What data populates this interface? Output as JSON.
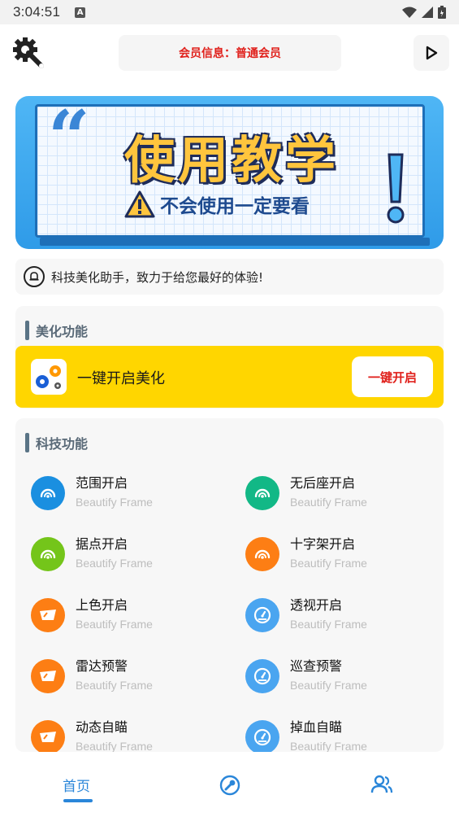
{
  "status_bar": {
    "time": "3:04:51",
    "badge": "A"
  },
  "header": {
    "settings_icon": "settings-wrench-icon",
    "member_info": "会员信息：普通会员",
    "play_icon": "play-icon"
  },
  "banner": {
    "quote_mark": "“",
    "title": "使用教学",
    "subtitle": "不会使用一定要看",
    "exclaim": "!"
  },
  "notice": {
    "icon": "bell-icon",
    "text": "科技美化助手，致力于给您最好的体验!"
  },
  "beautify_section": {
    "title": "美化功能",
    "row": {
      "label": "一键开启美化",
      "button": "一键开启",
      "icon": "gears-icon"
    }
  },
  "tech_section": {
    "title": "科技功能",
    "items": [
      {
        "name": "范围开启",
        "sub": "Beautify Frame",
        "color": "#1a8fe0",
        "icon": "gauge-icon"
      },
      {
        "name": "无后座开启",
        "sub": "Beautify Frame",
        "color": "#12b886",
        "icon": "gauge-icon"
      },
      {
        "name": "据点开启",
        "sub": "Beautify Frame",
        "color": "#74c51a",
        "icon": "gauge-icon"
      },
      {
        "name": "十字架开启",
        "sub": "Beautify Frame",
        "color": "#fd7e14",
        "icon": "gauge-icon"
      },
      {
        "name": "上色开启",
        "sub": "Beautify Frame",
        "color": "#fd7e14",
        "icon": "visor-icon"
      },
      {
        "name": "透视开启",
        "sub": "Beautify Frame",
        "color": "#4aa5f0",
        "icon": "speedometer-icon"
      },
      {
        "name": "雷达预警",
        "sub": "Beautify Frame",
        "color": "#fd7e14",
        "icon": "visor-icon"
      },
      {
        "name": "巡查预警",
        "sub": "Beautify Frame",
        "color": "#4aa5f0",
        "icon": "speedometer-icon"
      },
      {
        "name": "动态自瞄",
        "sub": "Beautify Frame",
        "color": "#fd7e14",
        "icon": "visor-icon"
      },
      {
        "name": "掉血自瞄",
        "sub": "Beautify Frame",
        "color": "#4aa5f0",
        "icon": "speedometer-icon"
      }
    ]
  },
  "bottom_nav": {
    "home_label": "首页",
    "tools_icon": "tools-icon",
    "user_icon": "users-icon",
    "accent": "#2a86d9"
  }
}
